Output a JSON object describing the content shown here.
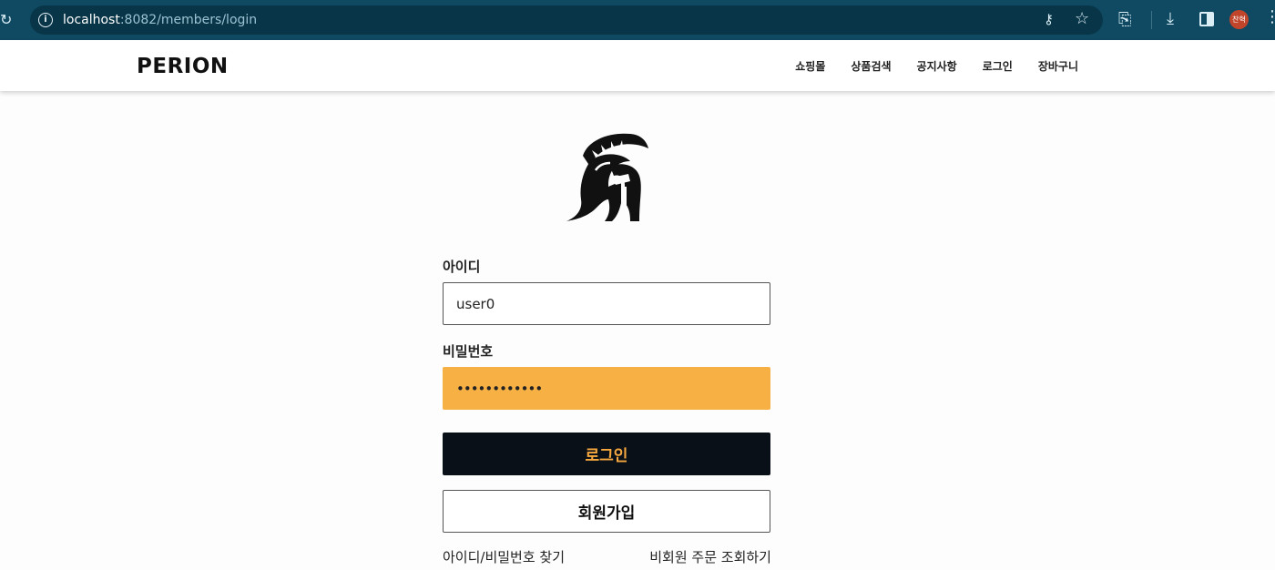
{
  "browser": {
    "url_host": "localhost",
    "url_path": ":8082/members/login",
    "profile_initials": "찬혁"
  },
  "header": {
    "brand": "PERION",
    "nav": [
      "쇼핑몰",
      "상품검색",
      "공지사항",
      "로그인",
      "장바구니"
    ]
  },
  "login": {
    "id_label": "아이디",
    "id_value": "user0",
    "password_label": "비밀번호",
    "password_value": "••••••••••••",
    "login_button": "로그인",
    "join_button": "회원가입",
    "find_link": "아이디/비밀번호 찾기",
    "guest_order_link": "비회원 주문 조회하기"
  },
  "colors": {
    "chrome_bar": "#0f4a62",
    "accent_orange": "#f7b043",
    "login_button_bg": "#0a1018"
  }
}
